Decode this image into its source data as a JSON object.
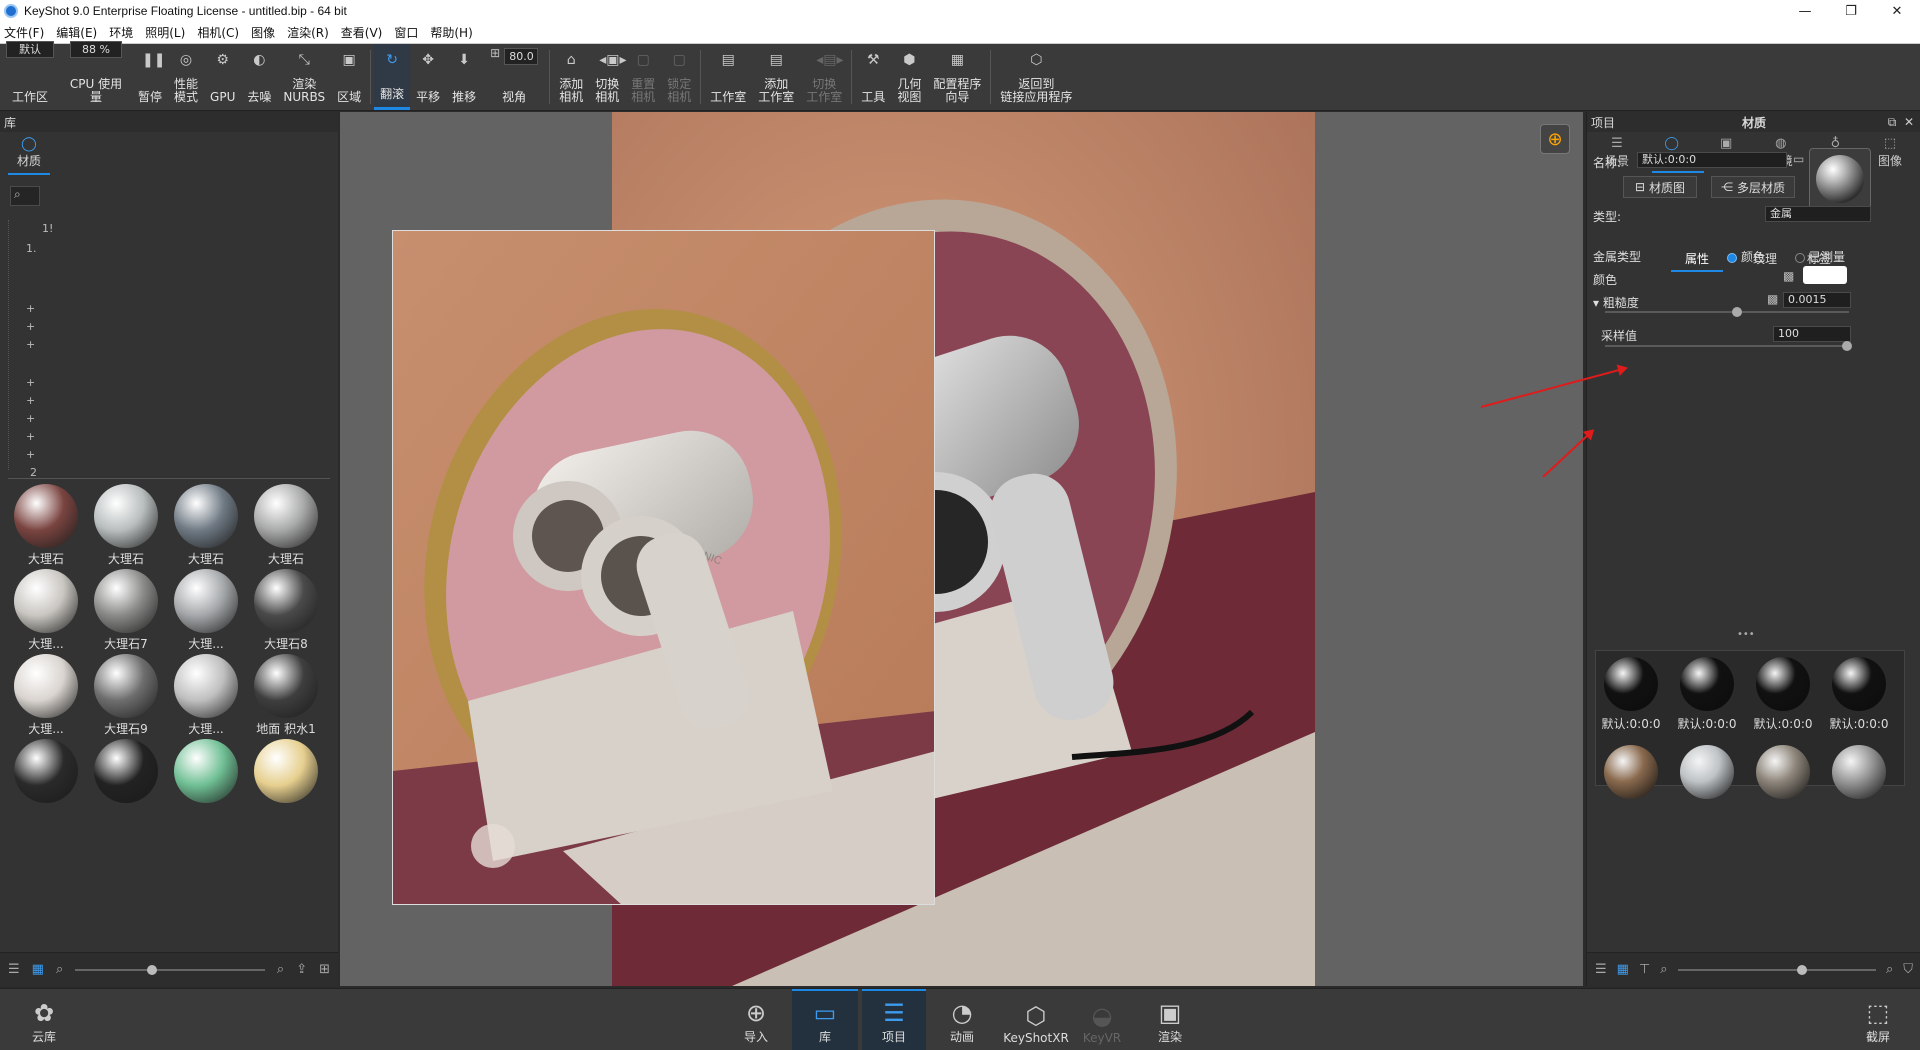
{
  "window": {
    "title": "KeyShot 9.0 Enterprise Floating License  - untitled.bip  - 64 bit",
    "min": "—",
    "max": "❐",
    "close": "✕"
  },
  "menu": [
    "文件(F)",
    "编辑(E)",
    "环境",
    "照明(L)",
    "相机(C)",
    "图像",
    "渲染(R)",
    "查看(V)",
    "窗口",
    "帮助(H)"
  ],
  "toolbar": {
    "workspace_field": "默认",
    "workspace_label": "工作区",
    "cpu_field": "88 %",
    "cpu_label": "CPU 使用量",
    "pause": "暂停",
    "perf": "性能\n模式",
    "gpu": "GPU",
    "denoise": "去噪",
    "nurbs": "渲染\nNURBS",
    "region": "区域",
    "tumble": "翻滚",
    "pan": "平移",
    "dolly": "推移",
    "fov_field": "80.0",
    "fov_label": "视角",
    "add_camera": "添加\n相机",
    "switch_camera": "切换\n相机",
    "reset_camera": "重置\n相机",
    "lock_camera": "锁定\n相机",
    "studio": "工作室",
    "add_studio": "添加\n工作室",
    "switch_studio": "切换\n工作室",
    "tools": "工具",
    "geometry_view": "几何\n视图",
    "config_wizard": "配置程序\n向导",
    "back_to_app": "返回到\n链接应用程序"
  },
  "library": {
    "header": "库",
    "tab": "材质",
    "search": "",
    "tree_rows": [
      "1!",
      "1.",
      "+",
      "+",
      "+",
      "+",
      "+",
      "+",
      "+",
      "+",
      "2"
    ],
    "thumbs": [
      {
        "label": "大理石",
        "color": "#7a4440"
      },
      {
        "label": "大理石",
        "color": "#b8bdbd"
      },
      {
        "label": "大理石",
        "color": "#6f7a84"
      },
      {
        "label": "大理石",
        "color": "#a8aaa9"
      },
      {
        "label": "大理...",
        "color": "#c9c6c1"
      },
      {
        "label": "大理石7",
        "color": "#8a8a88"
      },
      {
        "label": "大理...",
        "color": "#a5a8aa"
      },
      {
        "label": "大理石8",
        "color": "#4a4a4a"
      },
      {
        "label": "大理...",
        "color": "#d9d4cf"
      },
      {
        "label": "大理石9",
        "color": "#6e6e6e"
      },
      {
        "label": "大理...",
        "color": "#bfbfbf"
      },
      {
        "label": "地面 积水1",
        "color": "#3e3e3e"
      },
      {
        "label": "",
        "color": "#2a2a2a"
      },
      {
        "label": "",
        "color": "#222"
      },
      {
        "label": "",
        "color": "#6fbf94"
      },
      {
        "label": "",
        "color": "#e6cf8e"
      }
    ]
  },
  "project": {
    "header_left": "项目",
    "header_title": "材质",
    "tabs": [
      "场景",
      "材质",
      "相机",
      "环境",
      "照明",
      "图像"
    ],
    "name_label": "名称:",
    "name_value": "默认:0:0:0",
    "btn_material_graph": "材质图",
    "btn_multi_layer": "多层材质",
    "type_label": "类型:",
    "type_value": "金属",
    "subtabs": [
      "属性",
      "纹理",
      "标签"
    ],
    "metal_type_label": "金属类型",
    "metal_color_option": "颜色",
    "metal_measured_option": "已测量",
    "color_label": "颜色",
    "color_value": "#ffffff",
    "roughness_label": "粗糙度",
    "roughness_value": "0.0015",
    "samples_label": "采样值",
    "samples_value": "100",
    "dots": "•••",
    "swatches": [
      {
        "label": "默认:0:0:0",
        "color": "#111"
      },
      {
        "label": "默认:0:0:0",
        "color": "#111"
      },
      {
        "label": "默认:0:0:0",
        "color": "#111"
      },
      {
        "label": "默认:0:0:0",
        "color": "#111"
      },
      {
        "label": "",
        "color": "#8a6a4e"
      },
      {
        "label": "",
        "color": "#bfc3c6"
      },
      {
        "label": "",
        "color": "#8f877c"
      },
      {
        "label": "",
        "color": "#9a9a9a"
      }
    ]
  },
  "bottom": {
    "cloud": "云库",
    "import": "导入",
    "library": "库",
    "project": "项目",
    "animation": "动画",
    "keyshotxr": "KeyShotXR",
    "keyvr": "KeyVR",
    "render": "渲染",
    "screenshot": "截屏"
  },
  "render_image": {
    "brand_text": "FONIC"
  },
  "accent": "#1e88e5",
  "annotation_color": "#e01b1b"
}
